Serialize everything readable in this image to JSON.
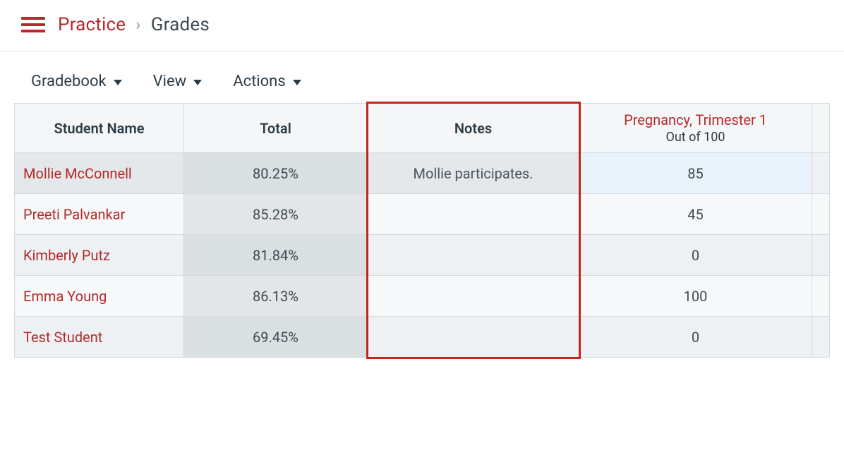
{
  "breadcrumb": {
    "link": "Practice",
    "separator": "›",
    "current": "Grades"
  },
  "toolbar": {
    "gradebook_label": "Gradebook",
    "view_label": "View",
    "actions_label": "Actions"
  },
  "table": {
    "columns": {
      "name": "Student Name",
      "total": "Total",
      "notes": "Notes",
      "assignment_title": "Pregnancy, Trimester 1",
      "assignment_sub": "Out of 100"
    },
    "rows": [
      {
        "name": "Mollie McConnell",
        "total": "80.25%",
        "notes": "Mollie participates.",
        "grade": "85"
      },
      {
        "name": "Preeti Palvankar",
        "total": "85.28%",
        "notes": "",
        "grade": "45"
      },
      {
        "name": "Kimberly Putz",
        "total": "81.84%",
        "notes": "",
        "grade": "0"
      },
      {
        "name": "Emma Young",
        "total": "86.13%",
        "notes": "",
        "grade": "100"
      },
      {
        "name": "Test Student",
        "total": "69.45%",
        "notes": "",
        "grade": "0"
      }
    ]
  },
  "highlight_column_index": 2
}
